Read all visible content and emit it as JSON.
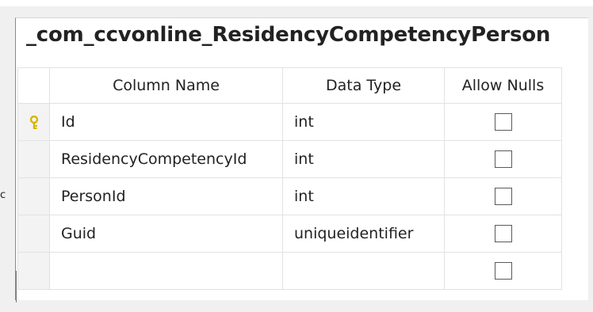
{
  "title": "_com_ccvonline_ResidencyCompetencyPerson",
  "headers": {
    "column_name": "Column Name",
    "data_type": "Data Type",
    "allow_nulls": "Allow Nulls"
  },
  "rows": [
    {
      "name": "Id",
      "type": "int",
      "primary_key": true,
      "allow_nulls": false
    },
    {
      "name": "ResidencyCompetencyId",
      "type": "int",
      "primary_key": false,
      "allow_nulls": false
    },
    {
      "name": "PersonId",
      "type": "int",
      "primary_key": false,
      "allow_nulls": false
    },
    {
      "name": "Guid",
      "type": "uniqueidentifier",
      "primary_key": false,
      "allow_nulls": false
    },
    {
      "name": "",
      "type": "",
      "primary_key": false,
      "allow_nulls": false
    }
  ],
  "colors": {
    "key_icon": "#d8b400",
    "selector_background": "#f3f3f3",
    "grid_line": "#e2e2e2"
  },
  "icons": {
    "primary_key": "key-icon"
  }
}
